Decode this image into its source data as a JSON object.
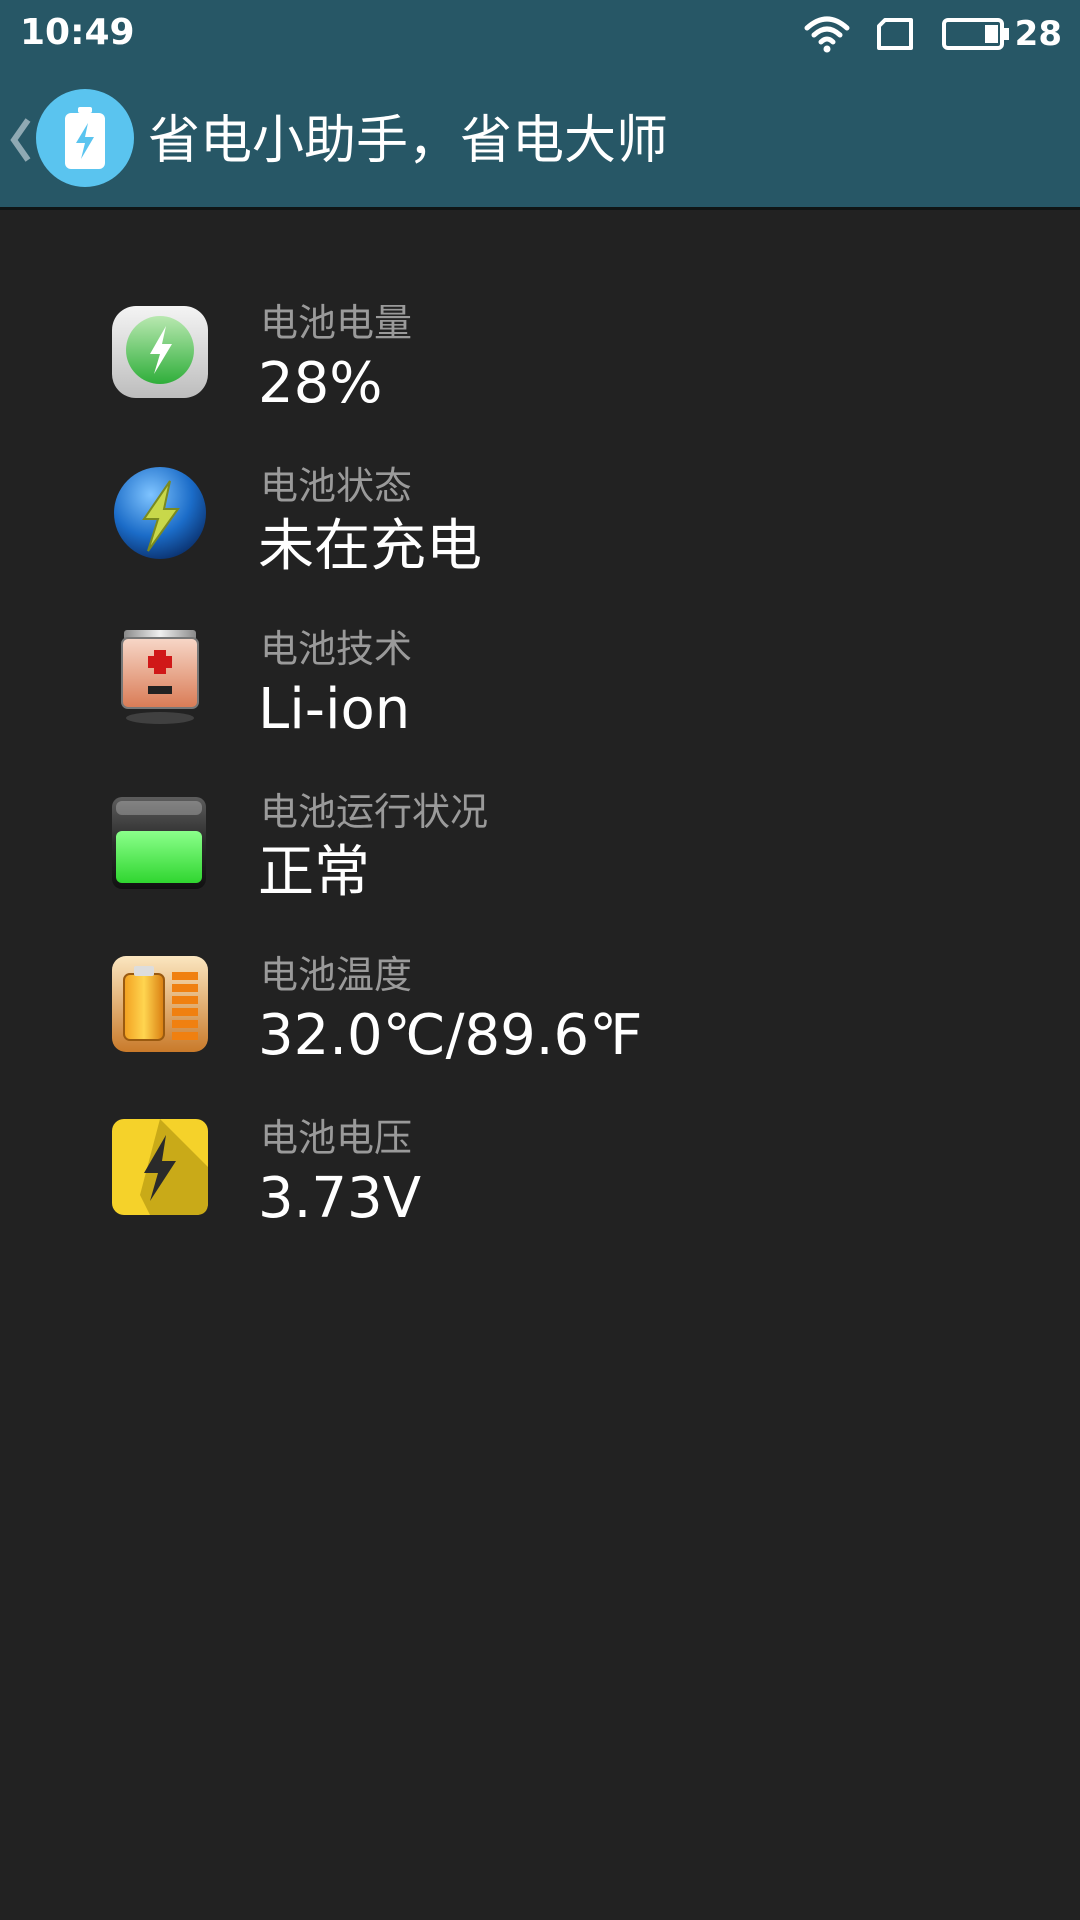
{
  "status_bar": {
    "time": "10:49",
    "battery_level": "28",
    "icons": [
      "wifi-icon",
      "sim-card-icon",
      "battery-icon"
    ]
  },
  "app_bar": {
    "back_icon": "chevron-left-icon",
    "logo_icon": "battery-charge-icon",
    "title": "省电小助手，省电大师"
  },
  "battery_info": [
    {
      "label": "电池电量",
      "value": "28%",
      "icon": "battery-level-icon"
    },
    {
      "label": "电池状态",
      "value": "未在充电",
      "icon": "lightning-orb-icon"
    },
    {
      "label": "电池技术",
      "value": "Li-ion",
      "icon": "battery-cell-icon"
    },
    {
      "label": "电池运行状况",
      "value": "正常",
      "icon": "battery-health-icon"
    },
    {
      "label": "电池温度",
      "value": "32.0℃/89.6℉",
      "icon": "temperature-battery-icon"
    },
    {
      "label": "电池电压",
      "value": "3.73V",
      "icon": "voltage-bolt-icon"
    }
  ],
  "colors": {
    "app_bar": "#275766",
    "background": "#222222",
    "label": "#9a9a9a",
    "value": "#ffffff",
    "logo": "#5ac4ef"
  }
}
